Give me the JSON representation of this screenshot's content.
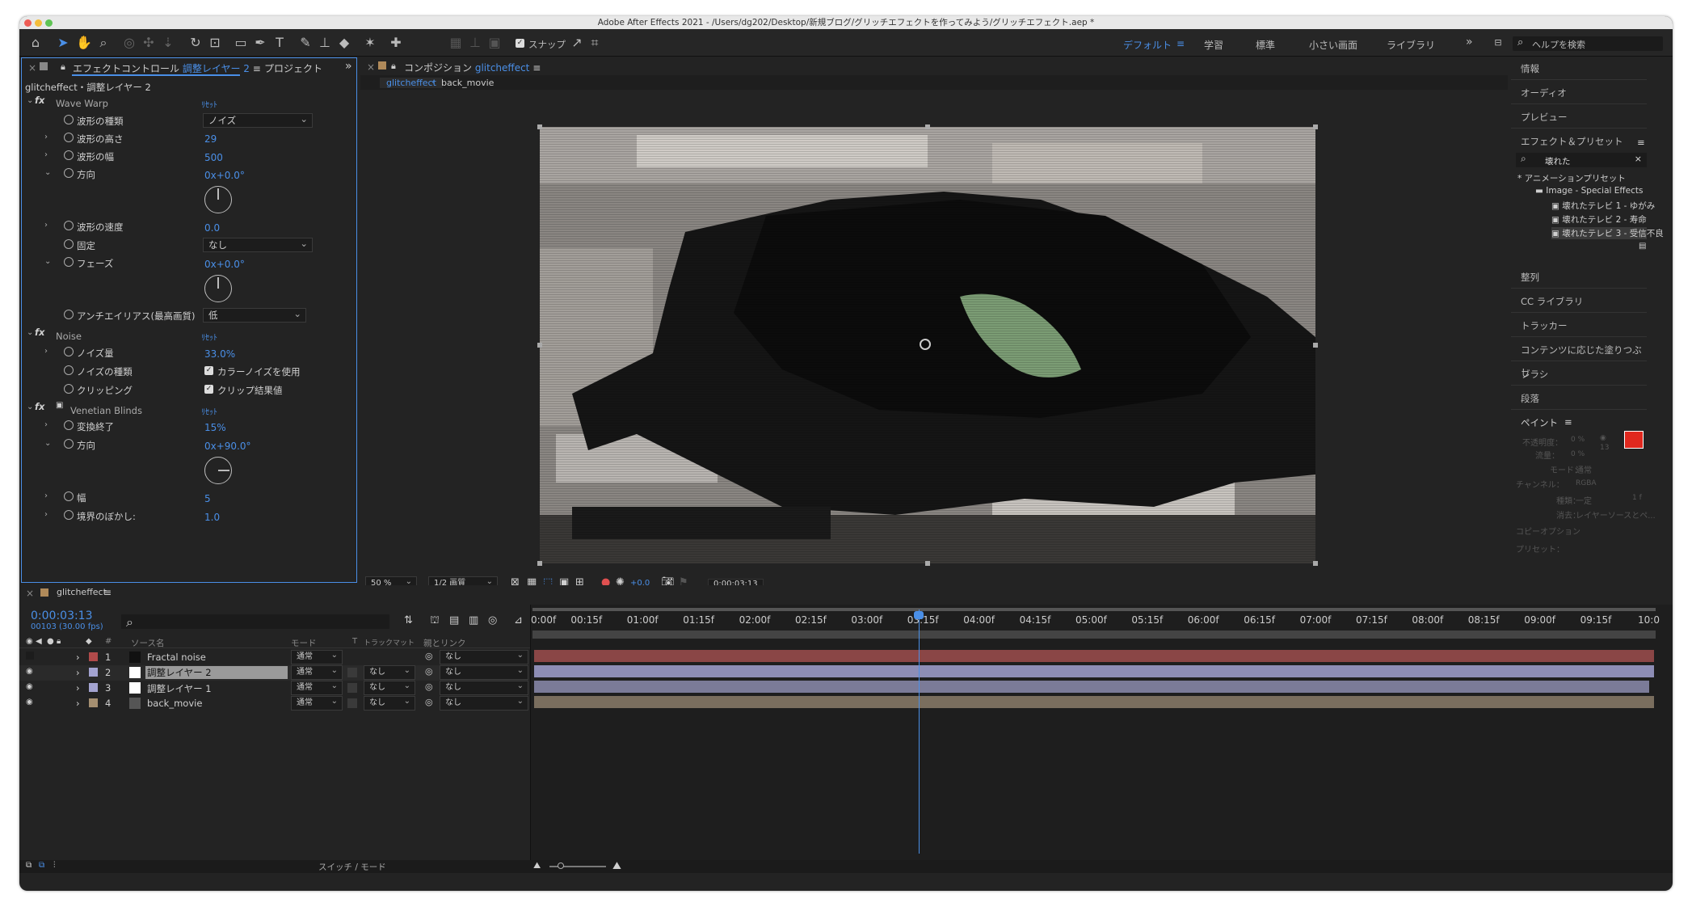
{
  "window": {
    "title": "Adobe After Effects 2021 - /Users/dg202/Desktop/新規ブログ/グリッチエフェクトを作ってみよう/グリッチエフェクト.aep *"
  },
  "toolbar": {
    "snap_label": "スナップ",
    "workspaces": [
      "デフォルト",
      "学習",
      "標準",
      "小さい画面",
      "ライブラリ"
    ],
    "help_search_placeholder": "ヘルプを検索"
  },
  "effect_controls": {
    "tab_label": "エフェクトコントロール",
    "tab_layer": "調整レイヤー 2",
    "project_tab": "プロジェクト",
    "breadcrumb": "glitcheffect・調整レイヤー 2",
    "reset_label": "ﾘｾｯﾄ",
    "wave_warp": {
      "name": "Wave Warp",
      "props": [
        {
          "label": "波形の種類",
          "value": "ノイズ"
        },
        {
          "label": "波形の高さ",
          "value": "29"
        },
        {
          "label": "波形の幅",
          "value": "500"
        },
        {
          "label": "方向",
          "value": "0x+0.0°"
        },
        {
          "label": "波形の速度",
          "value": "0.0"
        },
        {
          "label": "固定",
          "value": "なし"
        },
        {
          "label": "フェーズ",
          "value": "0x+0.0°"
        },
        {
          "label": "アンチエイリアス(最高画質)",
          "value": "低"
        }
      ]
    },
    "noise": {
      "name": "Noise",
      "props": [
        {
          "label": "ノイズ量",
          "value": "33.0%"
        },
        {
          "label": "ノイズの種類",
          "value": "カラーノイズを使用"
        },
        {
          "label": "クリッピング",
          "value": "クリップ結果値"
        }
      ]
    },
    "venetian": {
      "name": "Venetian Blinds",
      "props": [
        {
          "label": "変換終了",
          "value": "15%"
        },
        {
          "label": "方向",
          "value": "0x+90.0°"
        },
        {
          "label": "幅",
          "value": "5"
        },
        {
          "label": "境界のぼかし:",
          "value": "1.0"
        }
      ]
    }
  },
  "composition": {
    "tab_label": "コンポジション",
    "tab_name": "glitcheffect",
    "sub_tabs": [
      "glitcheffect",
      "back_movie"
    ],
    "zoom": "50 %",
    "resolution": "1/2 画質",
    "exposure": "+0.0",
    "timecode": "0:00:03:13"
  },
  "right_panel": {
    "items_top": [
      "情報",
      "オーディオ",
      "プレビュー"
    ],
    "effects_title": "エフェクト＆プリセット",
    "effects_search": "壊れた",
    "tree": [
      "* アニメーションプリセット",
      "Image - Special Effects",
      "壊れたテレビ 1 - ゆがみ",
      "壊れたテレビ 2 - 寿命",
      "壊れたテレビ 3 - 受信不良"
    ],
    "items_bottom": [
      "整列",
      "CC ライブラリ",
      "トラッカー",
      "コンテンツに応じた塗りつぶし",
      "ブラシ",
      "段落"
    ],
    "paint": {
      "title": "ペイント",
      "fg_color": "#e0281e",
      "rows": [
        {
          "label": "不透明度：",
          "value": "0 %"
        },
        {
          "label": "流量：",
          "value": "0 %"
        },
        {
          "label": "モード：",
          "value": "通常"
        },
        {
          "label": "チャンネル：",
          "value": "RGBA"
        },
        {
          "label": "種類：",
          "value": "一定"
        },
        {
          "label": "消去：",
          "value": "レイヤーソースとペ..."
        }
      ],
      "clone_label": "コピーオプション",
      "preset_label": "プリセット：",
      "num_13": "13",
      "num_1f": "1 f"
    }
  },
  "timeline": {
    "tab": "glitcheffect",
    "timecode": "0:00:03:13",
    "frames": "00103 (30.00 fps)",
    "headers": {
      "name": "ソース名",
      "mode": "モード",
      "t": "T",
      "trkmat": "トラックマット",
      "parent": "親とリンク",
      "num": "#"
    },
    "ruler": [
      "0:00f",
      "00:15f",
      "01:00f",
      "01:15f",
      "02:00f",
      "02:15f",
      "03:00f",
      "03:15f",
      "04:00f",
      "04:15f",
      "05:00f",
      "05:15f",
      "06:00f",
      "06:15f",
      "07:00f",
      "07:15f",
      "08:00f",
      "08:15f",
      "09:00f",
      "09:15f",
      "10:0"
    ],
    "layers": [
      {
        "num": "1",
        "name": "Fractal noise",
        "mode": "通常",
        "trk": "",
        "parent": "なし",
        "label_color": "#b04a4a",
        "bar_color": "#8a4646"
      },
      {
        "num": "2",
        "name": "調整レイヤー 2",
        "mode": "通常",
        "trk": "なし",
        "parent": "なし",
        "label_color": "#a3a3d0",
        "bar_color": "#8d8db5"
      },
      {
        "num": "3",
        "name": "調整レイヤー 1",
        "mode": "通常",
        "trk": "なし",
        "parent": "なし",
        "label_color": "#a3a3d0",
        "bar_color": "#7b7b98"
      },
      {
        "num": "4",
        "name": "back_movie",
        "mode": "通常",
        "trk": "なし",
        "parent": "なし",
        "label_color": "#a58f71",
        "bar_color": "#7a6e5e"
      }
    ],
    "footer": "スイッチ / モード"
  }
}
